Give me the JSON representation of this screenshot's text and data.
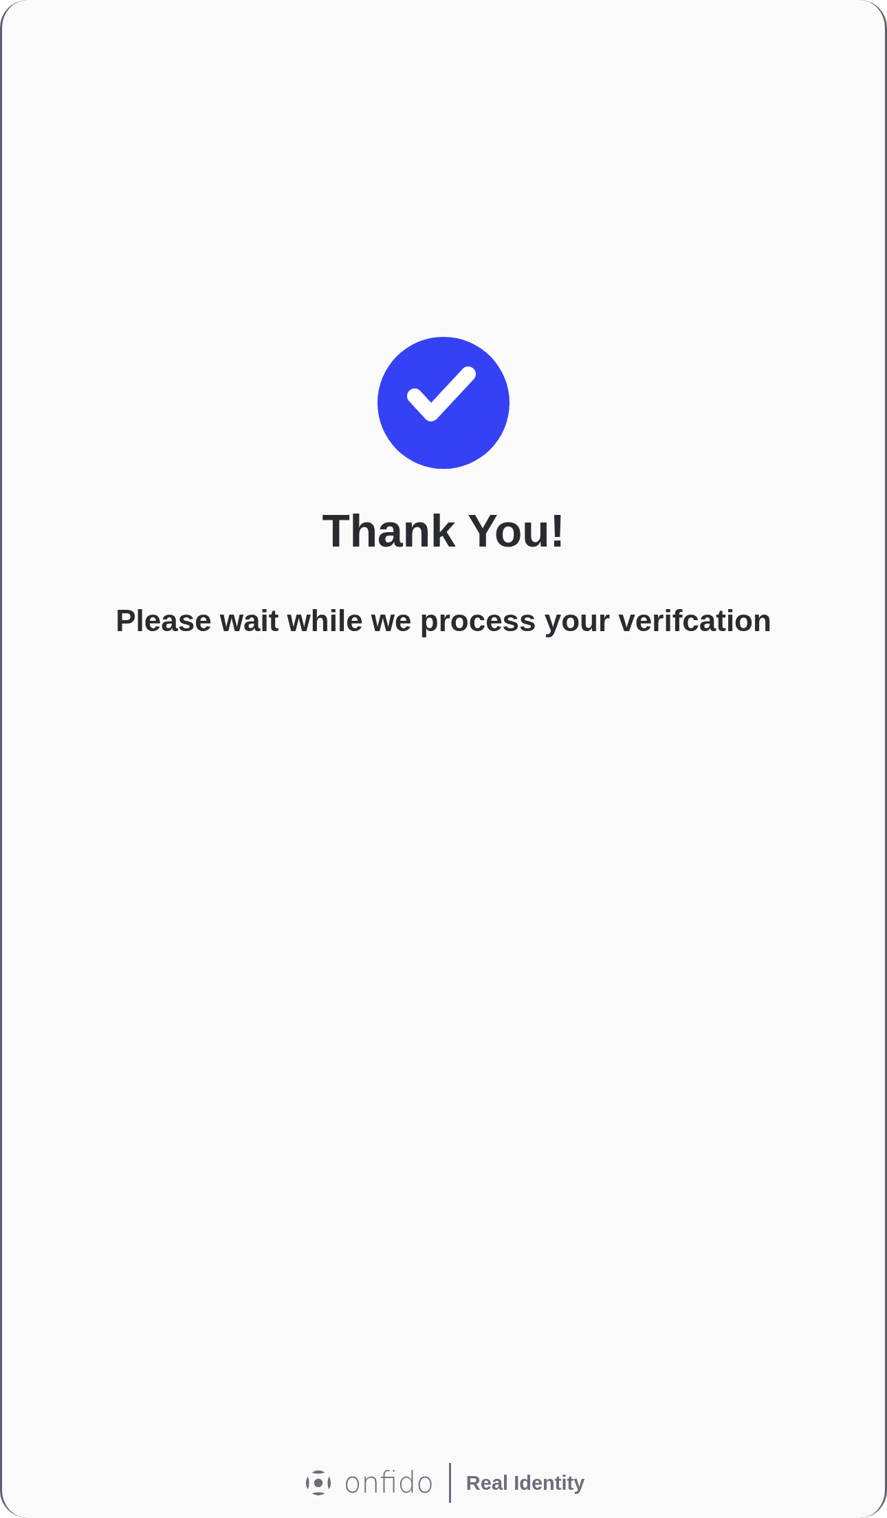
{
  "title": "Thank You!",
  "message": "Please wait while we process your verifcation",
  "footer": {
    "brand": "onfido",
    "tagline": "Real Identity"
  }
}
